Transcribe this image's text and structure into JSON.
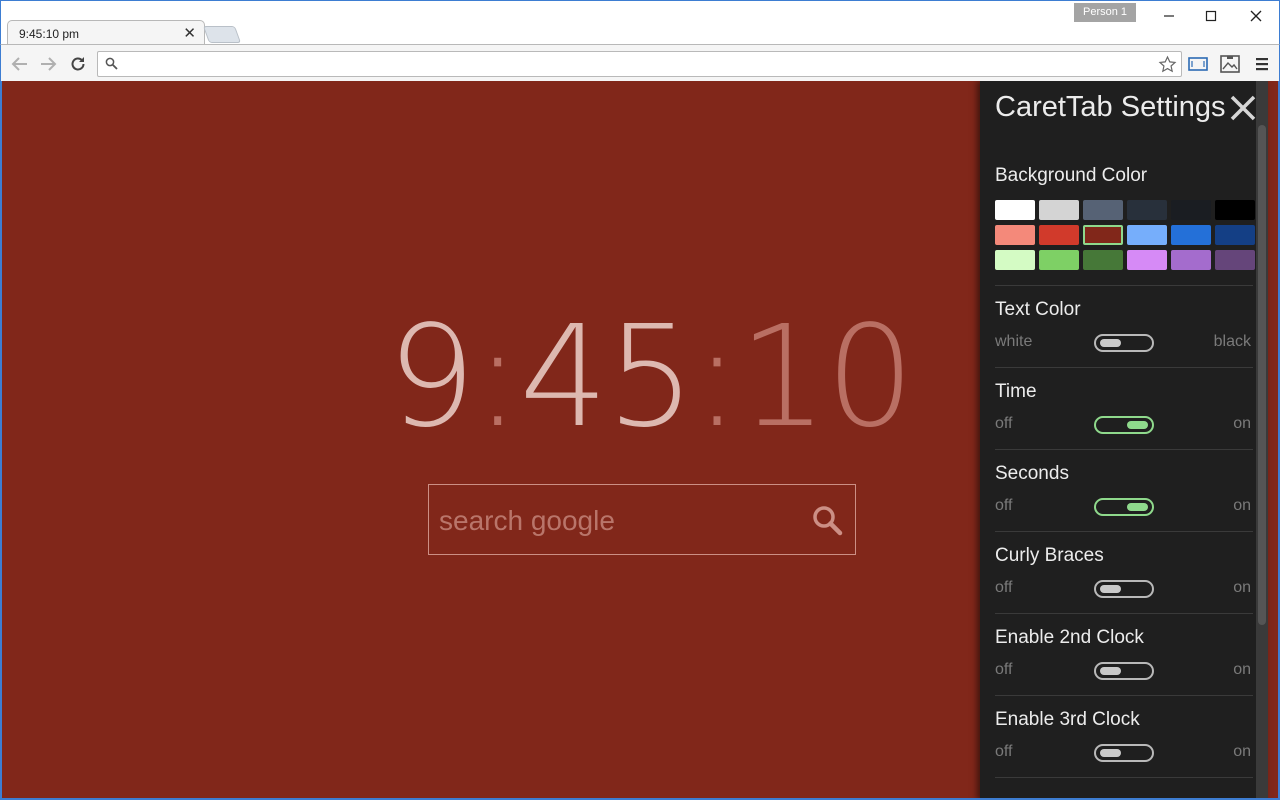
{
  "browser": {
    "tab_title": "9:45:10 pm",
    "tab_close": "✕",
    "profile": "Person 1",
    "url_value": "",
    "colors": {
      "frame_border": "#3d7dd2",
      "toolbar": "#f5f5f5"
    }
  },
  "page": {
    "background": "#81271a",
    "clock": {
      "hours": "9",
      "colon1": ":",
      "minutes": "45",
      "colon2": ":",
      "seconds": "10"
    },
    "search_placeholder": "search google"
  },
  "panel": {
    "title": "CaretTab Settings",
    "background_color": {
      "label": "Background Color",
      "swatches": [
        "#ffffff",
        "#d4d4d4",
        "#566275",
        "#28303b",
        "#1a1d22",
        "#000000",
        "#f4897a",
        "#d13a2b",
        "#81271a",
        "#76aefb",
        "#2470d8",
        "#143f85",
        "#d4fbc4",
        "#7ed065",
        "#467838",
        "#d68af6",
        "#a46ccd",
        "#65457a"
      ],
      "selected_index": 8
    },
    "options": [
      {
        "label": "Text Color",
        "left": "white",
        "right": "black",
        "state": "off"
      },
      {
        "label": "Time",
        "left": "off",
        "right": "on",
        "state": "on"
      },
      {
        "label": "Seconds",
        "left": "off",
        "right": "on",
        "state": "on"
      },
      {
        "label": "Curly Braces",
        "left": "off",
        "right": "on",
        "state": "off"
      },
      {
        "label": "Enable 2nd Clock",
        "left": "off",
        "right": "on",
        "state": "off"
      },
      {
        "label": "Enable 3rd Clock",
        "left": "off",
        "right": "on",
        "state": "off"
      }
    ],
    "accent": "#8fd98c"
  }
}
